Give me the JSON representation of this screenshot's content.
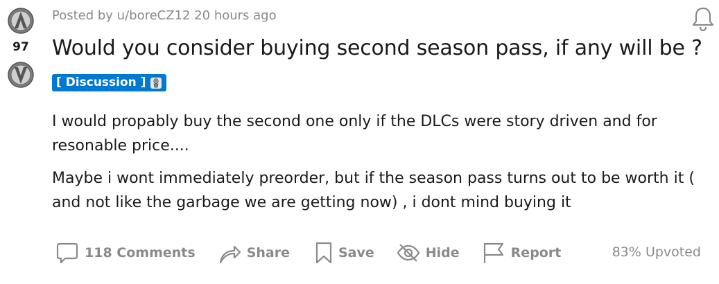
{
  "post": {
    "score": "97",
    "meta": "Posted by u/boreCZ12 20 hours ago",
    "title": "Would you consider buying second season pass, if any will be ?",
    "flair": "[ Discussion ]",
    "flair_emoji": "claptrap-emoji",
    "body": [
      "I would propably buy the second one only if the DLCs were story driven and for resonable price....",
      "Maybe i wont immediately preorder, but if the season pass turns out to be worth it ( and not like the garbage we are getting now) , i dont mind buying it"
    ]
  },
  "vote": {
    "up_icon": "upvote-vault-icon",
    "down_icon": "downvote-vault-icon"
  },
  "actions": {
    "comments": "118 Comments",
    "share": "Share",
    "save": "Save",
    "hide": "Hide",
    "report": "Report"
  },
  "upvoted": "83% Upvoted",
  "notification_icon": "bell-icon",
  "colors": {
    "flair_bg": "#0079d3",
    "meta": "#878a8c",
    "text": "#1a1a1b"
  }
}
